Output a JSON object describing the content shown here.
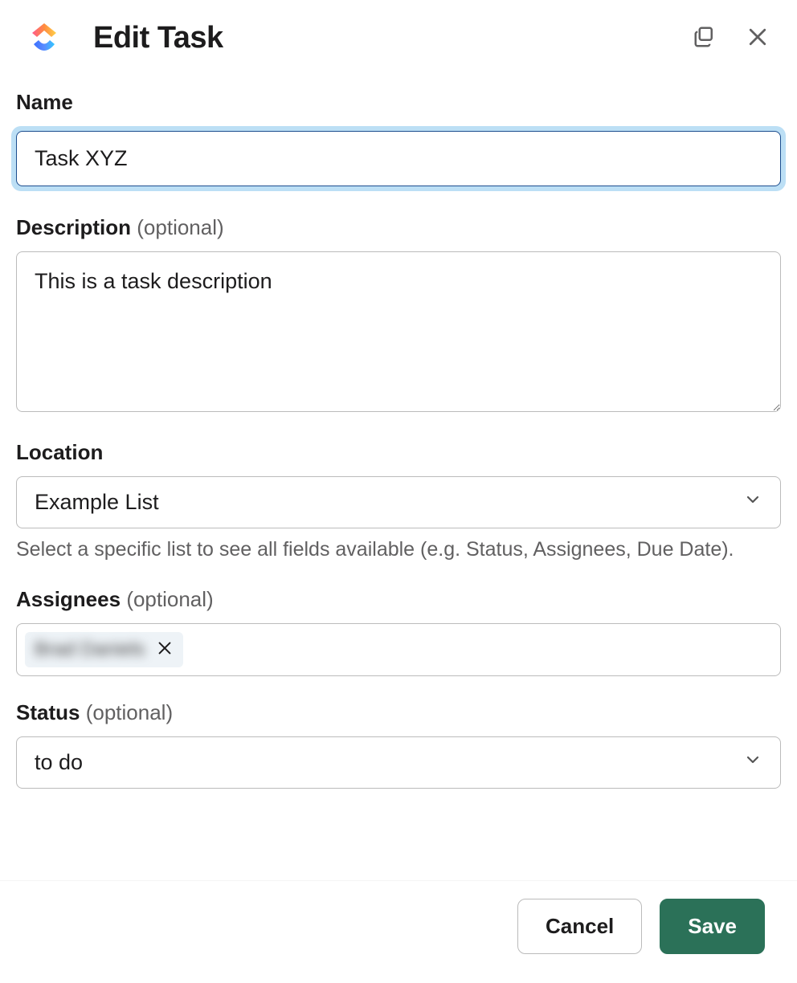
{
  "header": {
    "title": "Edit Task"
  },
  "fields": {
    "name": {
      "label": "Name",
      "value": "Task XYZ"
    },
    "description": {
      "label": "Description",
      "optional": "(optional)",
      "value": "This is a task description"
    },
    "location": {
      "label": "Location",
      "value": "Example List",
      "help": "Select a specific list to see all fields available (e.g. Status, Assignees, Due Date)."
    },
    "assignees": {
      "label": "Assignees",
      "optional": "(optional)",
      "chips": [
        {
          "text": "Brad Daniels"
        }
      ]
    },
    "status": {
      "label": "Status",
      "optional": "(optional)",
      "value": "to do"
    }
  },
  "footer": {
    "cancel": "Cancel",
    "save": "Save"
  }
}
